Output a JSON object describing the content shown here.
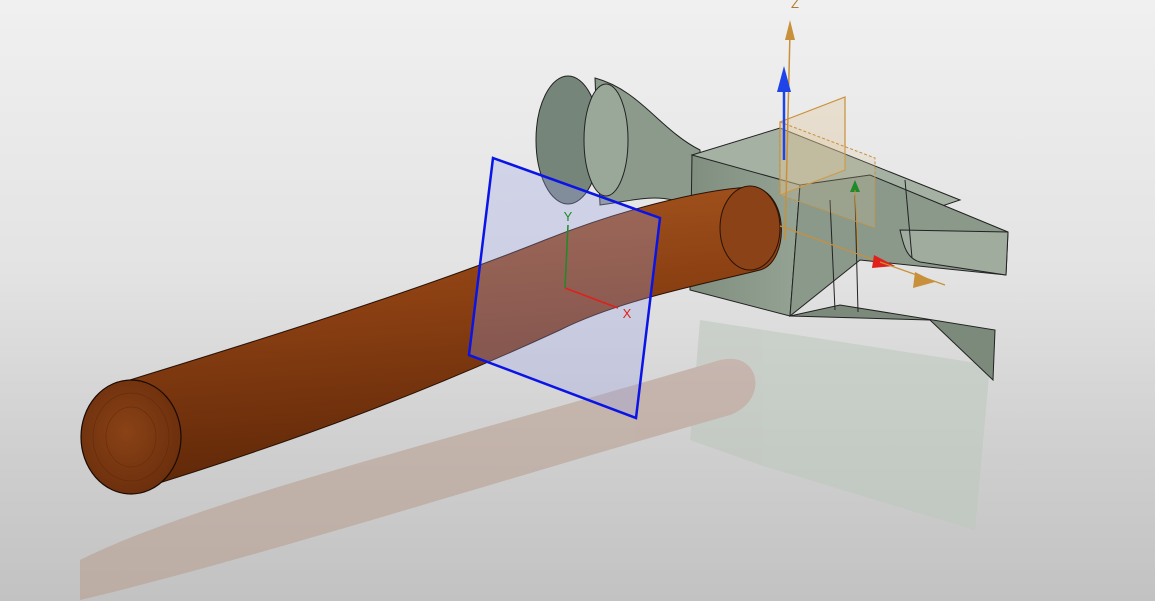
{
  "viewport": {
    "part_name": "hammer",
    "main_triad": {
      "z_label": "Z"
    },
    "sketch_plane_triad": {
      "x_label": "X",
      "y_label": "Y"
    }
  },
  "colors": {
    "head": "#8b9a8a",
    "head_dark": "#6f7c6e",
    "head_light": "#a9b6a8",
    "handle": "#8a3f12",
    "handle_end": "#7b3710",
    "sketch_plane": "#0a14e6",
    "x_axis": "#e0201a",
    "y_axis": "#1e8a2a",
    "z_axis": "#1e44e8",
    "manipulator": "#c8903a"
  }
}
